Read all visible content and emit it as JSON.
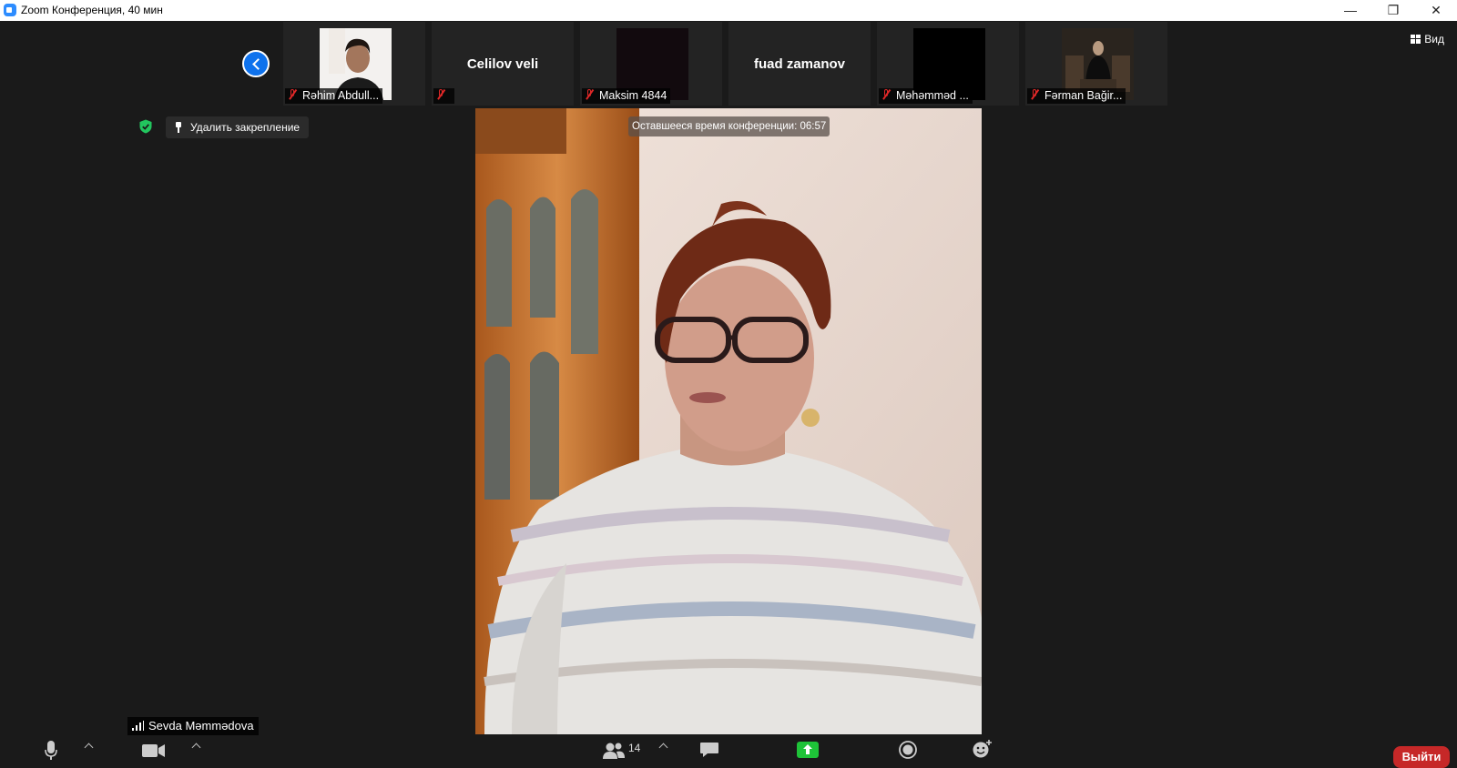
{
  "window": {
    "title": "Zoom Конференция, 40 мин",
    "minimize_label": "—",
    "restore_label": "❐",
    "close_label": "✕"
  },
  "gallery": {
    "view_label": "Вид",
    "tiles": [
      {
        "caption": "Rəhim Abdull...",
        "big_name": "",
        "has_video": true
      },
      {
        "caption": "",
        "big_name": "Celilov veli",
        "has_video": false
      },
      {
        "caption": "Maksim 4844",
        "big_name": "",
        "has_video": true
      },
      {
        "caption": "",
        "big_name": "fuad zamanov",
        "has_video": false
      },
      {
        "caption": "Məhəmməd ...",
        "big_name": "",
        "has_video": true
      },
      {
        "caption": "Fərman Bağir...",
        "big_name": "",
        "has_video": true
      }
    ]
  },
  "pin": {
    "unpin_label": "Удалить закрепление"
  },
  "main": {
    "timer_label": "Оставшееся время конференции: 06:57",
    "speaker_name": "Sevda Məmmədova"
  },
  "toolbar": {
    "participants_count": "14",
    "leave_label": "Выйти"
  },
  "colors": {
    "accent_blue": "#0e72ed",
    "leave_red": "#c62828",
    "share_green": "#1ec338",
    "security_green": "#22c55e",
    "mute_red": "#e02828"
  }
}
